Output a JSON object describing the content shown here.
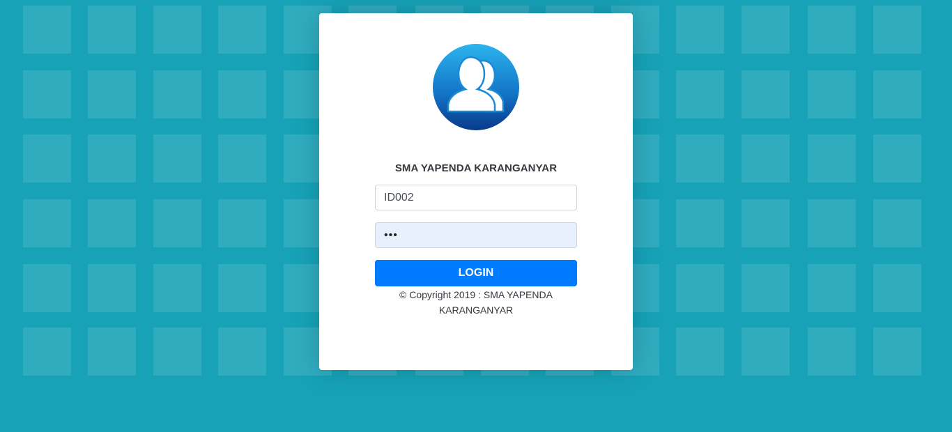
{
  "login": {
    "title": "SMA YAPENDA KARANGANYAR",
    "username_value": "ID002",
    "password_value": "•••",
    "login_label": "LOGIN",
    "copyright": "© Copyright 2019 : SMA YAPENDA KARANGANYAR",
    "logo_icon": "users-group-icon"
  },
  "colors": {
    "background": "#17a2b8",
    "button": "#007bff",
    "logo_top": "#2ab0ea",
    "logo_bottom": "#0a3d8f"
  }
}
